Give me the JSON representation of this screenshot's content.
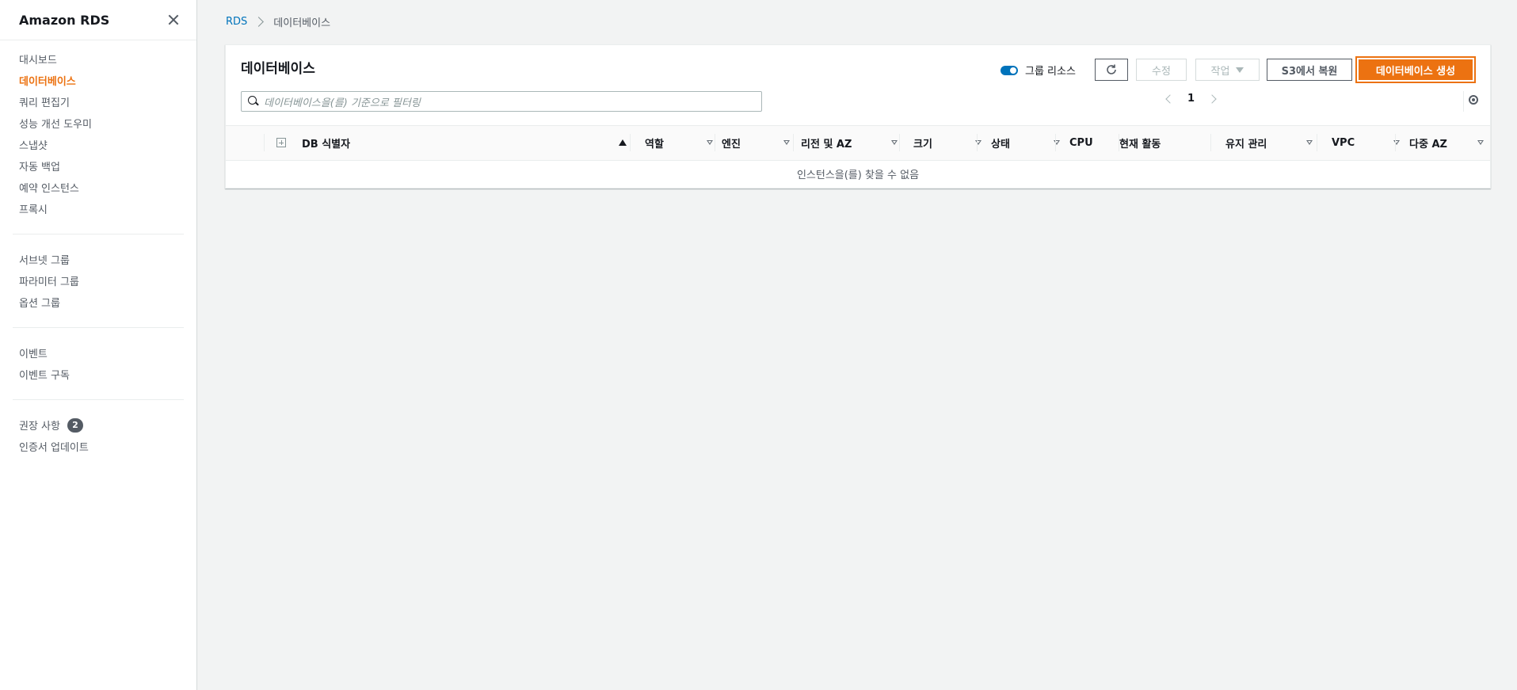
{
  "sidebar": {
    "title": "Amazon RDS",
    "group1": [
      {
        "label": "대시보드"
      },
      {
        "label": "데이터베이스"
      },
      {
        "label": "쿼리 편집기"
      },
      {
        "label": "성능 개선 도우미"
      },
      {
        "label": "스냅샷"
      },
      {
        "label": "자동 백업"
      },
      {
        "label": "예약 인스턴스"
      },
      {
        "label": "프록시"
      }
    ],
    "group2": [
      {
        "label": "서브넷 그룹"
      },
      {
        "label": "파라미터 그룹"
      },
      {
        "label": "옵션 그룹"
      }
    ],
    "group3": [
      {
        "label": "이벤트"
      },
      {
        "label": "이벤트 구독"
      }
    ],
    "group4": [
      {
        "label": "권장 사항",
        "badge": "2"
      },
      {
        "label": "인증서 업데이트"
      }
    ]
  },
  "breadcrumb": {
    "root": "RDS",
    "current": "데이터베이스"
  },
  "panel": {
    "title": "데이터베이스",
    "group_toggle_label": "그룹 리소스",
    "buttons": {
      "modify": "수정",
      "actions": "작업",
      "restore_s3": "S3에서 복원",
      "create": "데이터베이스 생성"
    },
    "search_placeholder": "데이터베이스을(를) 기준으로 필터링",
    "page": "1",
    "columns": [
      "DB 식별자",
      "역할",
      "엔진",
      "리전 및 AZ",
      "크기",
      "상태",
      "CPU",
      "현재 활동",
      "유지 관리",
      "VPC",
      "다중 AZ"
    ],
    "empty_message": "인스턴스을(를) 찾을 수 없음"
  },
  "colors": {
    "accent": "#ec7211",
    "link": "#0073bb"
  }
}
